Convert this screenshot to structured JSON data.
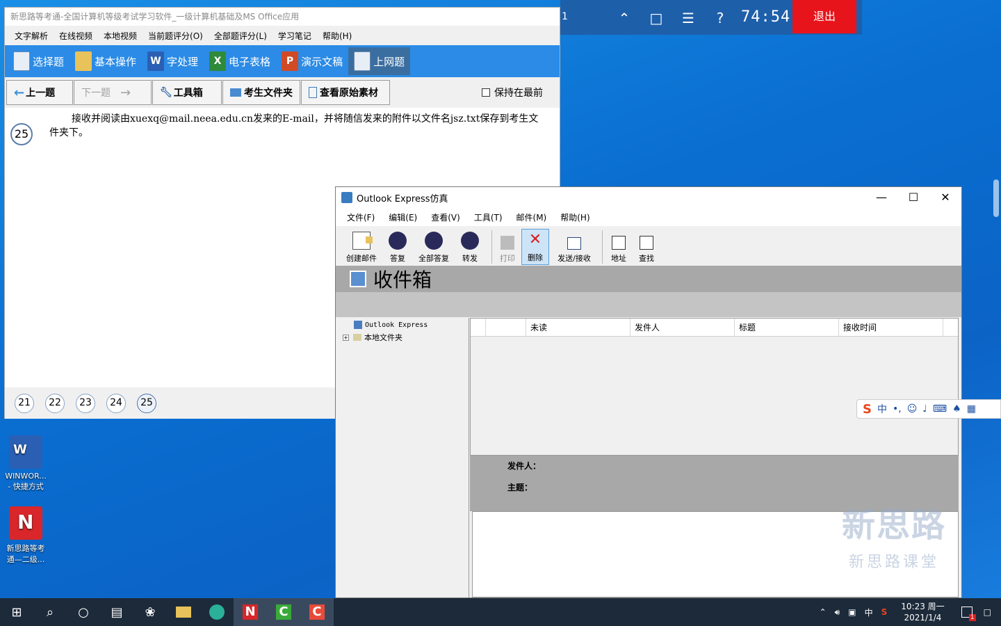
{
  "exam_window": {
    "title": "新思路等考通-全国计算机等级考试学习软件_一级计算机基础及MS Office应用",
    "menu": [
      "文字解析",
      "在线视频",
      "本地视频",
      "当前题评分(O)",
      "全部题评分(L)",
      "学习笔记",
      "帮助(H)"
    ],
    "tabs": [
      "选择题",
      "基本操作",
      "字处理",
      "电子表格",
      "演示文稿",
      "上网题"
    ],
    "active_tab": "上网题",
    "toolbar": {
      "prev": "上一题",
      "next": "下一题",
      "toolbox": "工具箱",
      "student_folder": "考生文件夹",
      "view_material": "查看原始素材",
      "keep_front": "保持在最前"
    },
    "question_number": "25",
    "question_text": "接收并阅读由xuexq@mail.neea.edu.cn发来的E-mail，并将随信发来的附件以文件名jsz.txt保存到考生文件夹下。",
    "question_nav": [
      "21",
      "22",
      "23",
      "24",
      "25"
    ],
    "active_question": "25"
  },
  "exam_topbar": {
    "left_fragment": "1",
    "timer": "74:54",
    "exit_label": "退出",
    "help_label": "?"
  },
  "outlook_window": {
    "title": "Outlook Express仿真",
    "menu": [
      "文件(F)",
      "编辑(E)",
      "查看(V)",
      "工具(T)",
      "邮件(M)",
      "帮助(H)"
    ],
    "toolbar": {
      "create": "创建邮件",
      "reply": "答复",
      "reply_all": "全部答复",
      "forward": "转发",
      "print": "打印",
      "delete": "删除",
      "send_receive": "发送/接收",
      "address": "地址",
      "find": "查找"
    },
    "inbox_title": "收件箱",
    "folders": [
      "Outlook Express",
      "本地文件夹"
    ],
    "list_columns": [
      "未读",
      "发件人",
      "标题",
      "接收时间"
    ],
    "preview": {
      "from_label": "发件人：",
      "subject_label": "主题："
    }
  },
  "desktop_icons": [
    {
      "label1": "WINWOR...",
      "label2": "- 快捷方式"
    },
    {
      "label1": "新思路等考",
      "label2": "通—二级..."
    }
  ],
  "ime_bar": {
    "lang": "中"
  },
  "watermark": {
    "big": "新思路",
    "small": "新思路课堂"
  },
  "taskbar": {
    "time": "10:23 周一",
    "date": "2021/1/4",
    "ime": "中",
    "notification_count": "1"
  }
}
